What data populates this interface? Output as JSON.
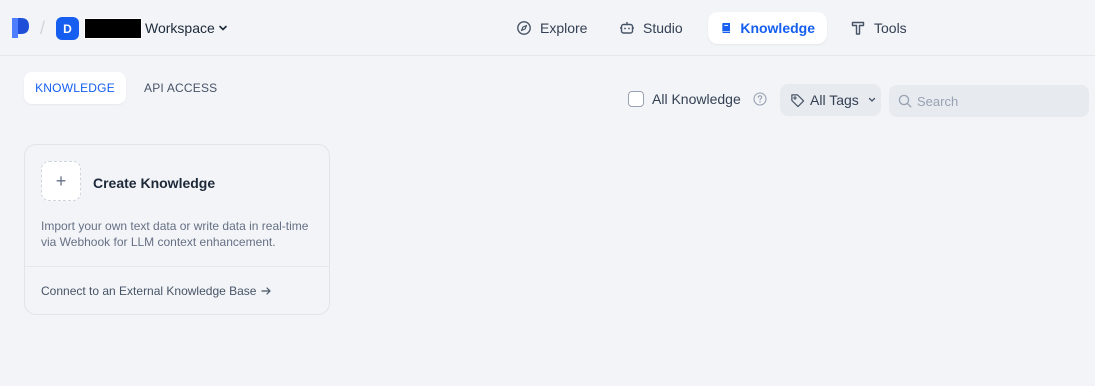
{
  "header": {
    "workspace": {
      "initial": "D",
      "label": "Workspace"
    },
    "nav": [
      {
        "label": "Explore",
        "icon": "compass-icon"
      },
      {
        "label": "Studio",
        "icon": "robot-icon"
      },
      {
        "label": "Knowledge",
        "icon": "book-icon",
        "active": true
      },
      {
        "label": "Tools",
        "icon": "hammer-icon"
      }
    ]
  },
  "tabs": [
    {
      "label": "KNOWLEDGE",
      "active": true
    },
    {
      "label": "API ACCESS"
    }
  ],
  "filters": {
    "all_knowledge_label": "All Knowledge",
    "all_knowledge_checked": false,
    "tags_label": "All Tags",
    "search_placeholder": "Search"
  },
  "create_card": {
    "title": "Create Knowledge",
    "description": "Import your own text data or write data in real-time via Webhook for LLM context enhancement.",
    "external_link": "Connect to an External Knowledge Base"
  },
  "colors": {
    "accent": "#155eef",
    "background": "#f2f4f7"
  }
}
